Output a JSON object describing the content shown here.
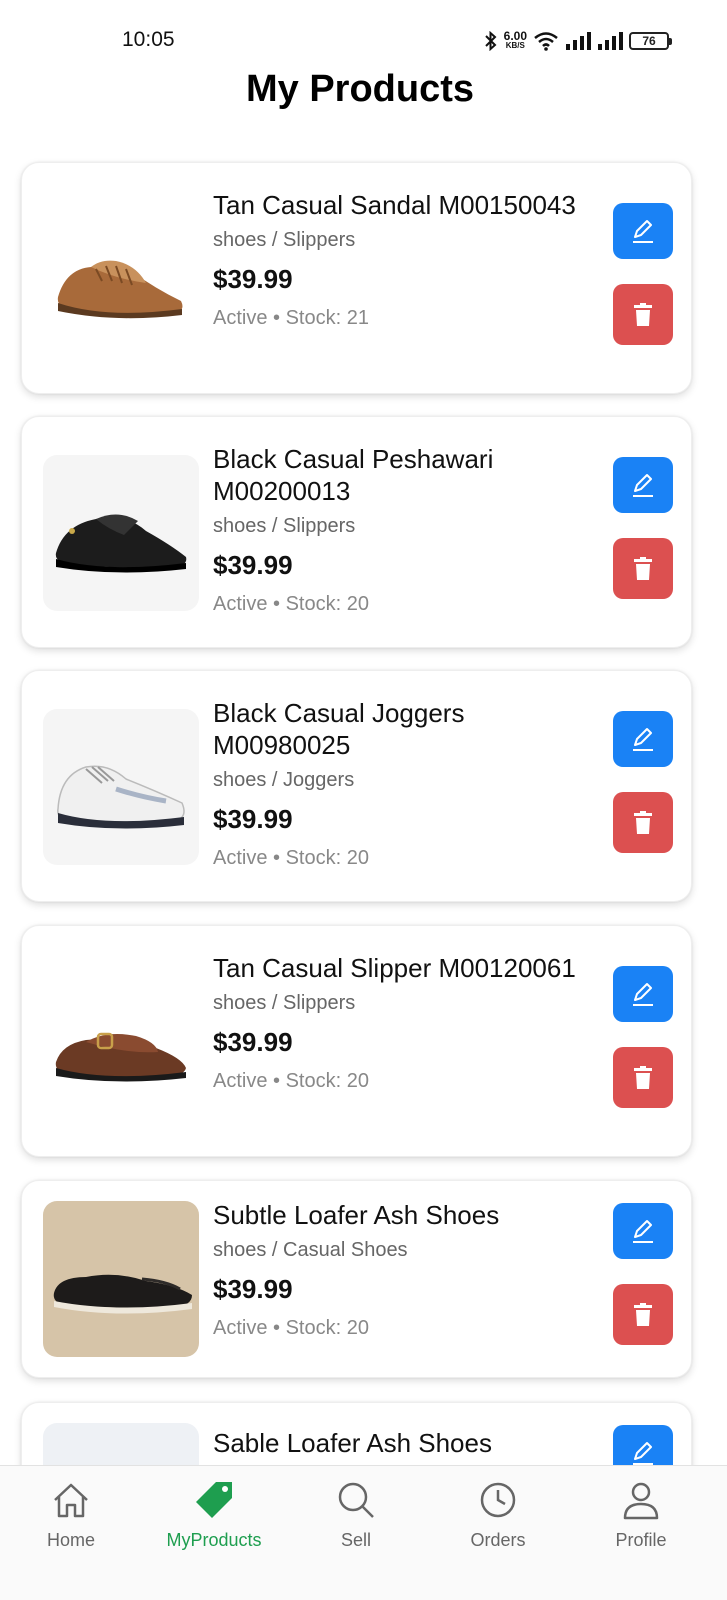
{
  "status_bar": {
    "time": "10:05",
    "net_speed": "6.00",
    "net_unit": "KB/S",
    "battery": "76"
  },
  "header": {
    "title": "My Products"
  },
  "colors": {
    "edit": "#1a82f5",
    "delete": "#dc5050",
    "active_nav": "#1e9e4f"
  },
  "products": [
    {
      "name": "Tan Casual Sandal M00150043",
      "category": "shoes / Slippers",
      "price": "$39.99",
      "meta": "Active • Stock: 21",
      "image": "tan-sandal",
      "edit_icon": "pencil-icon",
      "delete_icon": "trash-icon"
    },
    {
      "name": "Black Casual Peshawari M00200013",
      "category": "shoes / Slippers",
      "price": "$39.99",
      "meta": "Active • Stock: 20",
      "image": "black-peshawari",
      "edit_icon": "pencil-icon",
      "delete_icon": "trash-icon"
    },
    {
      "name": "Black Casual Joggers M00980025",
      "category": "shoes / Joggers",
      "price": "$39.99",
      "meta": "Active • Stock: 20",
      "image": "white-sneaker",
      "edit_icon": "pencil-icon",
      "delete_icon": "trash-icon"
    },
    {
      "name": "Tan Casual Slipper M00120061",
      "category": "shoes / Slippers",
      "price": "$39.99",
      "meta": "Active • Stock: 20",
      "image": "brown-slipper",
      "edit_icon": "pencil-icon",
      "delete_icon": "trash-icon"
    },
    {
      "name": "Subtle Loafer Ash Shoes",
      "category": "shoes / Casual Shoes",
      "price": "$39.99",
      "meta": "Active • Stock: 20",
      "image": "black-loafer",
      "edit_icon": "pencil-icon",
      "delete_icon": "trash-icon"
    },
    {
      "name": "Sable Loafer Ash Shoes",
      "image": "loafer",
      "edit_icon": "pencil-icon"
    }
  ],
  "nav": {
    "home": {
      "label": "Home",
      "icon": "home-icon"
    },
    "myproducts": {
      "label": "MyProducts",
      "icon": "tag-icon"
    },
    "sell": {
      "label": "Sell",
      "icon": "search-icon"
    },
    "orders": {
      "label": "Orders",
      "icon": "clock-icon"
    },
    "profile": {
      "label": "Profile",
      "icon": "person-icon"
    }
  }
}
